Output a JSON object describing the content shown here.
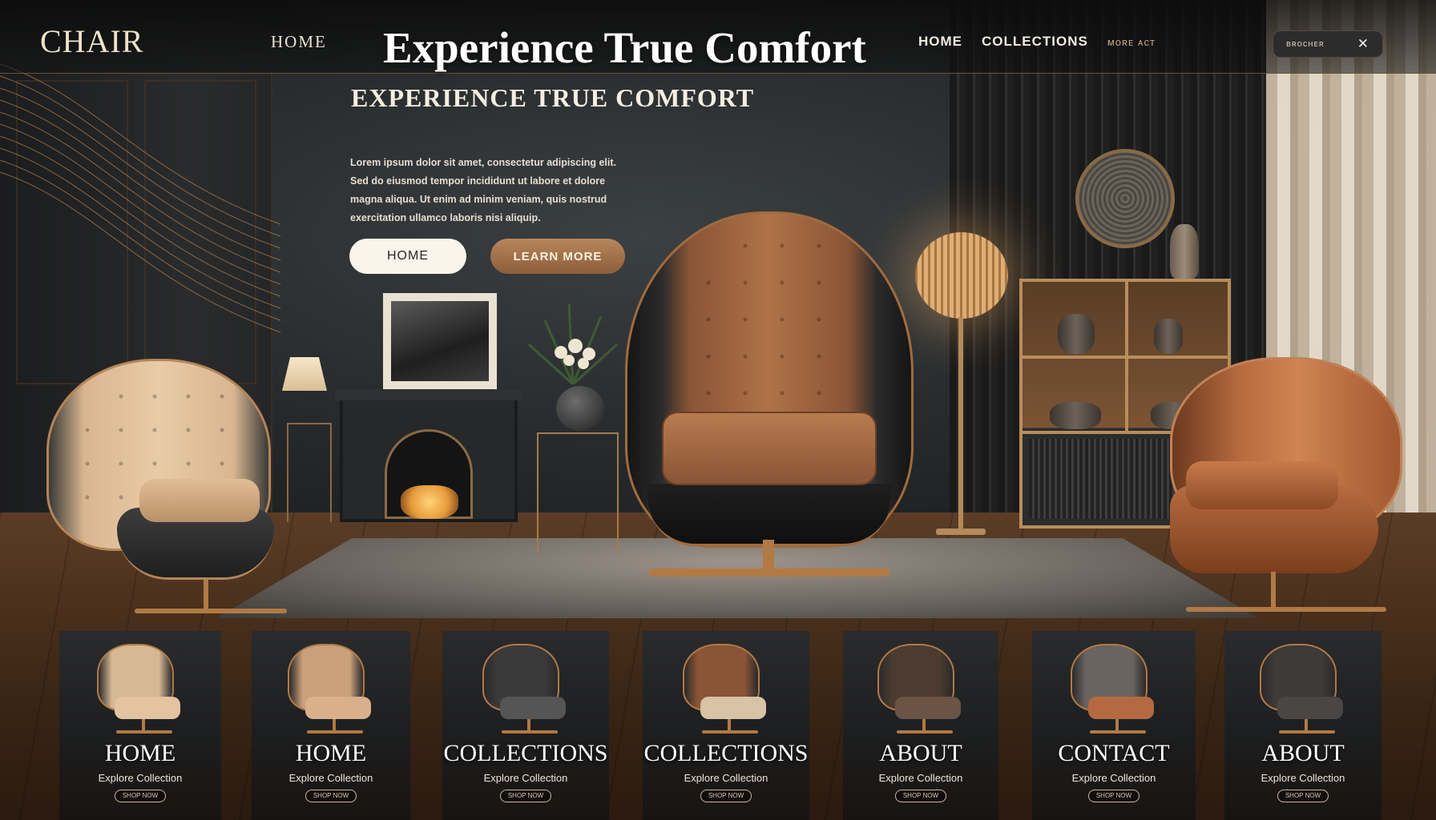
{
  "header": {
    "logo": "CHAIR",
    "nav_home_left": "HOME",
    "hero_title": "Experience True Comfort",
    "nav_right": [
      {
        "label": "HOME",
        "style": "bold"
      },
      {
        "label": "COLLECTIONS",
        "style": "bold"
      },
      {
        "label": "ᴍᴏʀᴇ ᴀᴄᴛ",
        "style": "dim"
      }
    ],
    "pill_label": "ʙʀᴏᴄʜᴇʀ",
    "pill_close": "✕"
  },
  "hero": {
    "subtitle": "EXPERIENCE TRUE COMFORT",
    "body_lines": [
      "Lorem ipsum dolor sit amet, consectetur adipiscing elit.",
      "Sed do eiusmod tempor incididunt ut labore et dolore",
      "magna aliqua. Ut enim ad minim veniam, quis nostrud",
      "exercitation ullamco laboris nisi aliquip."
    ],
    "buttons": {
      "primary": "HOME",
      "secondary": "LEARN MORE"
    }
  },
  "cards": [
    {
      "label": "HOME",
      "sub": "Explore Collection",
      "button": "SHOP NOW",
      "back_color": "#d7b894",
      "seat_color": "#e3c3a0"
    },
    {
      "label": "HOME",
      "sub": "Explore Collection",
      "button": "SHOP NOW",
      "back_color": "#c9a07a",
      "seat_color": "#d9b08a"
    },
    {
      "label": "COLLECTIONS",
      "sub": "Explore Collection",
      "button": "SHOP NOW",
      "back_color": "#3a3a3a",
      "seat_color": "#555555"
    },
    {
      "label": "COLLECTIONS",
      "sub": "Explore Collection",
      "button": "SHOP NOW",
      "back_color": "#8a5436",
      "seat_color": "#d8c3a6"
    },
    {
      "label": "ABOUT",
      "sub": "Explore Collection",
      "button": "SHOP NOW",
      "back_color": "#4b3b30",
      "seat_color": "#6b5444"
    },
    {
      "label": "CONTACT",
      "sub": "Explore Collection",
      "button": "SHOP NOW",
      "back_color": "#6a6360",
      "seat_color": "#b46a40"
    },
    {
      "label": "ABOUT",
      "sub": "Explore Collection",
      "button": "SHOP NOW",
      "back_color": "#3d3a38",
      "seat_color": "#4a4644"
    }
  ],
  "colors": {
    "accent": "#b17a45",
    "text": "#f3ece2",
    "background": "#1c1d1e"
  }
}
